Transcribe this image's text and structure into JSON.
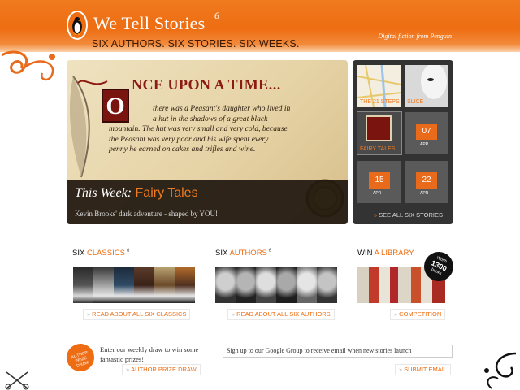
{
  "header": {
    "title": "We Tell Stories",
    "title_sup": "6",
    "tagline": "SIX AUTHORS. SIX STORIES. SIX WEEKS.",
    "subtitle": "Digital fiction from Penguin"
  },
  "feature": {
    "heading": "NCE UPON A TIME...",
    "dropcap": "O",
    "story_lines": [
      "there was a Peasant's daughter who lived in",
      "a hut in the shadows of a great black",
      "mountain. The hut was very small and very cold, because",
      "the Peasant was very poor and his wife spent every",
      "penny he earned on cakes and trifles and wine."
    ],
    "caption_label": "This Week:",
    "caption_value": "Fairy Tales",
    "caption_desc": "Kevin Brooks' dark adventure - shaped by YOU!"
  },
  "stories": {
    "tiles": [
      {
        "label": "THE 21 STEPS",
        "num": ""
      },
      {
        "label": "SLICE",
        "num": ""
      },
      {
        "label": "FAIRY TALES",
        "num": ""
      },
      {
        "label": "",
        "num": "07",
        "sub": "APR"
      },
      {
        "label": "",
        "num": "15",
        "sub": "APR"
      },
      {
        "label": "",
        "num": "22",
        "sub": "APR"
      }
    ],
    "see_all": "SEE ALL SIX STORIES"
  },
  "sections": {
    "classics_prefix": "SIX",
    "classics_hl": "CLASSICS",
    "classics_sup": "6",
    "classics_link": "READ ABOUT ALL SIX CLASSICS",
    "authors_prefix": "SIX",
    "authors_hl": "AUTHORS",
    "authors_sup": "6",
    "authors_link": "READ ABOUT ALL SIX AUTHORS",
    "library_prefix": "WIN",
    "library_hl": "A LIBRARY",
    "library_link": "COMPETITION",
    "badge_top": "Worth",
    "badge_num": "1300",
    "badge_bottom": "books"
  },
  "draw": {
    "badge_lines": [
      "AUTHOR",
      "PRIZE",
      "DRAW"
    ],
    "text": "Enter our weekly draw to win some fantastic prizes!",
    "link": "AUTHOR PRIZE DRAW"
  },
  "signup": {
    "text": "Sign up to our Google Group to receive email when new stories launch",
    "link": "SUBMIT EMAIL"
  },
  "colors": {
    "accent": "#ee6d12",
    "dark": "#333333"
  }
}
